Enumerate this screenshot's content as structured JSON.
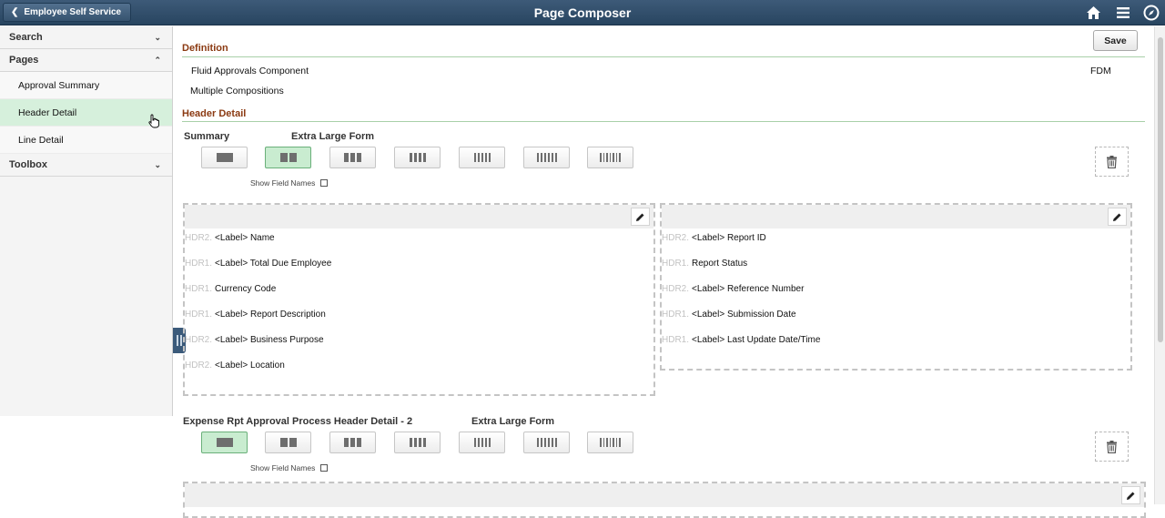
{
  "header": {
    "back_label": "Employee Self Service",
    "title": "Page Composer"
  },
  "sidebar": {
    "sections": {
      "search": "Search",
      "pages": "Pages",
      "toolbox": "Toolbox"
    },
    "pages_items": [
      {
        "label": "Approval Summary",
        "active": false
      },
      {
        "label": "Header Detail",
        "active": true
      },
      {
        "label": "Line Detail",
        "active": false
      }
    ]
  },
  "toolbar": {
    "save_label": "Save"
  },
  "definition": {
    "title": "Definition",
    "component": "Fluid Approvals Component",
    "compositions": "Multiple Compositions",
    "code": "FDM"
  },
  "header_detail": {
    "title": "Header Detail",
    "group1": {
      "name": "Summary",
      "form_size": "Extra Large Form",
      "show_field_names": "Show Field Names",
      "selected_layout_columns": 2,
      "left_fields": [
        {
          "tag": "HDR2.",
          "text": "<Label> Name"
        },
        {
          "tag": "HDR1.",
          "text": "<Label> Total Due Employee"
        },
        {
          "tag": "HDR1.",
          "text": "Currency Code"
        },
        {
          "tag": "HDR1.",
          "text": "<Label> Report Description"
        },
        {
          "tag": "HDR2.",
          "text": "<Label> Business Purpose"
        },
        {
          "tag": "HDR2.",
          "text": "<Label> Location"
        }
      ],
      "right_fields": [
        {
          "tag": "HDR2.",
          "text": "<Label> Report ID"
        },
        {
          "tag": "HDR1.",
          "text": "Report Status"
        },
        {
          "tag": "HDR2.",
          "text": "<Label> Reference Number"
        },
        {
          "tag": "HDR1.",
          "text": "<Label> Submission Date"
        },
        {
          "tag": "HDR1.",
          "text": "<Label> Last Update Date/Time"
        }
      ]
    },
    "group2": {
      "name": "Expense Rpt Approval Process Header Detail - 2",
      "form_size": "Extra Large Form",
      "show_field_names": "Show Field Names",
      "selected_layout_columns": 1
    }
  },
  "colors": {
    "header_bg": "#2f4c69",
    "section_title": "#8b3a12",
    "selected_green": "#c9ecd0",
    "nav_active": "#d6f0dc"
  },
  "icons": [
    "home-icon",
    "hamburger-menu-icon",
    "navbar-compass-icon",
    "trash-icon",
    "pencil-icon",
    "chevron-down-icon",
    "chevron-up-icon",
    "chevron-left-icon"
  ]
}
